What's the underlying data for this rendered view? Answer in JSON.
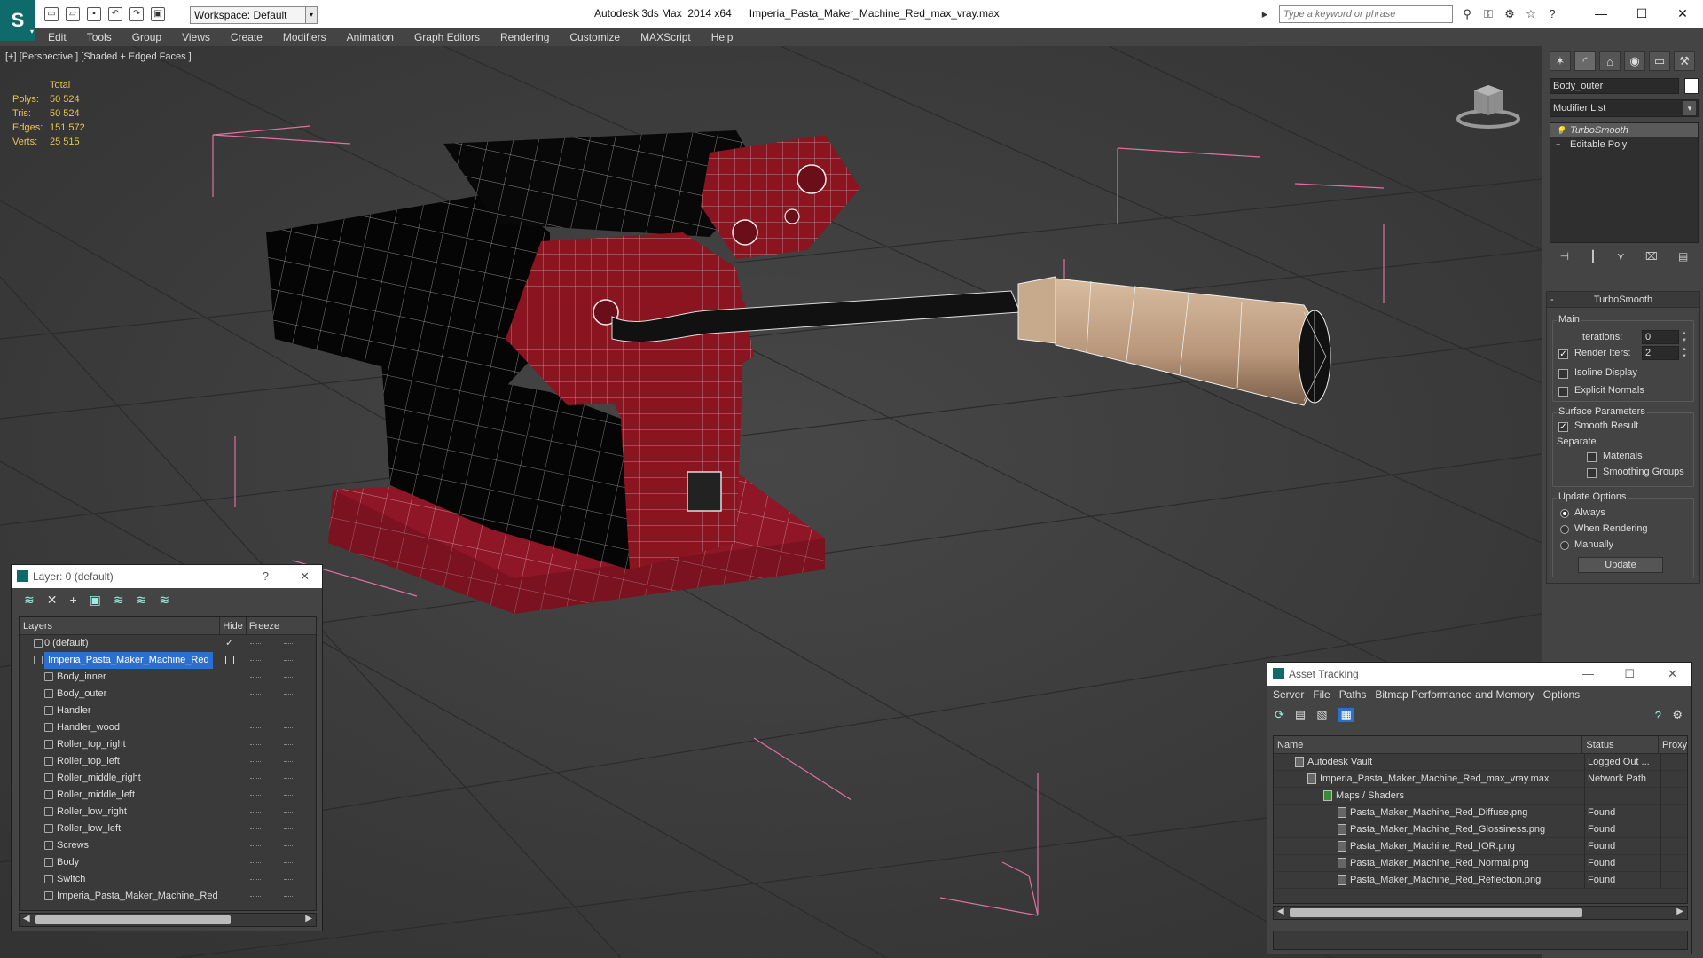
{
  "app": {
    "title": "Autodesk 3ds Max  2014 x64      Imperia_Pasta_Maker_Machine_Red_max_vray.max",
    "workspace": "Workspace: Default",
    "search_placeholder": "Type a keyword or phrase"
  },
  "menu": [
    "Edit",
    "Tools",
    "Group",
    "Views",
    "Create",
    "Modifiers",
    "Animation",
    "Graph Editors",
    "Rendering",
    "Customize",
    "MAXScript",
    "Help"
  ],
  "viewport": {
    "label": "[+] [Perspective ] [Shaded + Edged Faces ]",
    "stats_header": "Total",
    "stats": [
      {
        "key": "Polys:",
        "value": "50 524"
      },
      {
        "key": "Tris:",
        "value": "50 524"
      },
      {
        "key": "Edges:",
        "value": "151 572"
      },
      {
        "key": "Verts:",
        "value": "25 515"
      }
    ]
  },
  "command_panel": {
    "object_name": "Body_outer",
    "modifier_list": "Modifier List",
    "stack": [
      "TurboSmooth",
      "Editable Poly"
    ],
    "rollout_title": "TurboSmooth",
    "main_label": "Main",
    "iterations_label": "Iterations:",
    "iterations_value": "0",
    "render_iters_label": "Render Iters:",
    "render_iters_value": "2",
    "isoline_label": "Isoline Display",
    "explicit_normals_label": "Explicit Normals",
    "surface_params_label": "Surface Parameters",
    "smooth_result_label": "Smooth Result",
    "separate_label": "Separate",
    "materials_label": "Materials",
    "smoothing_groups_label": "Smoothing Groups",
    "update_options_label": "Update Options",
    "always_label": "Always",
    "when_rendering_label": "When Rendering",
    "manually_label": "Manually",
    "update_button": "Update"
  },
  "layer_window": {
    "title": "Layer: 0 (default)",
    "help": "?",
    "columns": {
      "layers": "Layers",
      "hide": "Hide",
      "freeze": "Freeze"
    },
    "rows": [
      {
        "name": "0 (default)",
        "indent": 1
      },
      {
        "name": "Imperia_Pasta_Maker_Machine_Red",
        "indent": 1
      },
      {
        "name": "Body_inner",
        "indent": 2
      },
      {
        "name": "Body_outer",
        "indent": 2
      },
      {
        "name": "Handler",
        "indent": 2
      },
      {
        "name": "Handler_wood",
        "indent": 2
      },
      {
        "name": "Roller_top_right",
        "indent": 2
      },
      {
        "name": "Roller_top_left",
        "indent": 2
      },
      {
        "name": "Roller_middle_right",
        "indent": 2
      },
      {
        "name": "Roller_middle_left",
        "indent": 2
      },
      {
        "name": "Roller_low_right",
        "indent": 2
      },
      {
        "name": "Roller_low_left",
        "indent": 2
      },
      {
        "name": "Screws",
        "indent": 2
      },
      {
        "name": "Body",
        "indent": 2
      },
      {
        "name": "Switch",
        "indent": 2
      },
      {
        "name": "Imperia_Pasta_Maker_Machine_Red",
        "indent": 2
      }
    ]
  },
  "asset_window": {
    "title": "Asset Tracking",
    "menu": [
      "Server",
      "File",
      "Paths",
      "Bitmap Performance and Memory",
      "Options"
    ],
    "columns": {
      "name": "Name",
      "status": "Status",
      "proxy": "Proxy"
    },
    "rows": [
      {
        "name": "Autodesk Vault",
        "status": "Logged Out ...",
        "indent": 1
      },
      {
        "name": "Imperia_Pasta_Maker_Machine_Red_max_vray.max",
        "status": "Network Path",
        "indent": 2
      },
      {
        "name": "Maps / Shaders",
        "status": "",
        "indent": 3
      },
      {
        "name": "Pasta_Maker_Machine_Red_Diffuse.png",
        "status": "Found",
        "indent": 4
      },
      {
        "name": "Pasta_Maker_Machine_Red_Glossiness.png",
        "status": "Found",
        "indent": 4
      },
      {
        "name": "Pasta_Maker_Machine_Red_IOR.png",
        "status": "Found",
        "indent": 4
      },
      {
        "name": "Pasta_Maker_Machine_Red_Normal.png",
        "status": "Found",
        "indent": 4
      },
      {
        "name": "Pasta_Maker_Machine_Red_Reflection.png",
        "status": "Found",
        "indent": 4
      }
    ]
  },
  "colors": {
    "accent": "#2d6fd1",
    "body_red": "#8a1420",
    "wood": "#c9a98a",
    "stats": "#e6c650"
  }
}
